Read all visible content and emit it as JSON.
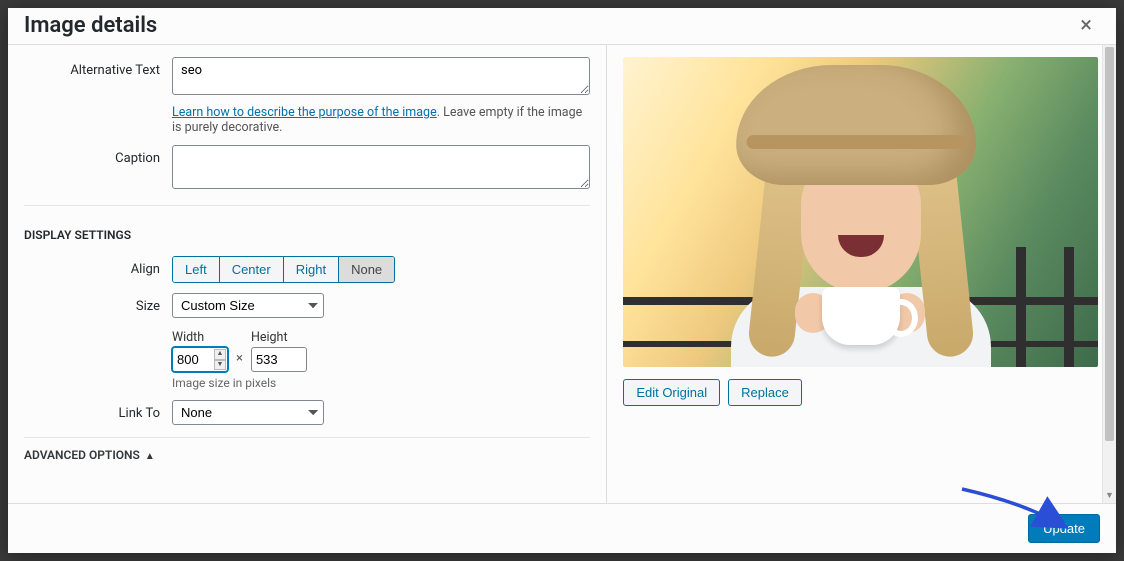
{
  "modal": {
    "title": "Image details",
    "close_symbol": "×"
  },
  "fields": {
    "alt_label": "Alternative Text",
    "alt_value": "seo",
    "alt_help_link": "Learn how to describe the purpose of the image",
    "alt_help_rest": ". Leave empty if the image is purely decorative.",
    "caption_label": "Caption",
    "caption_value": ""
  },
  "display": {
    "heading": "DISPLAY SETTINGS",
    "align_label": "Align",
    "align_options": {
      "left": "Left",
      "center": "Center",
      "right": "Right",
      "none": "None"
    },
    "align_selected": "none",
    "size_label": "Size",
    "size_selected": "Custom Size",
    "width_label": "Width",
    "width_value": "800",
    "height_label": "Height",
    "height_value": "533",
    "dim_hint": "Image size in pixels",
    "linkto_label": "Link To",
    "linkto_selected": "None"
  },
  "advanced": {
    "toggle_label": "ADVANCED OPTIONS"
  },
  "preview": {
    "edit_label": "Edit Original",
    "replace_label": "Replace"
  },
  "footer": {
    "update_label": "Update"
  }
}
